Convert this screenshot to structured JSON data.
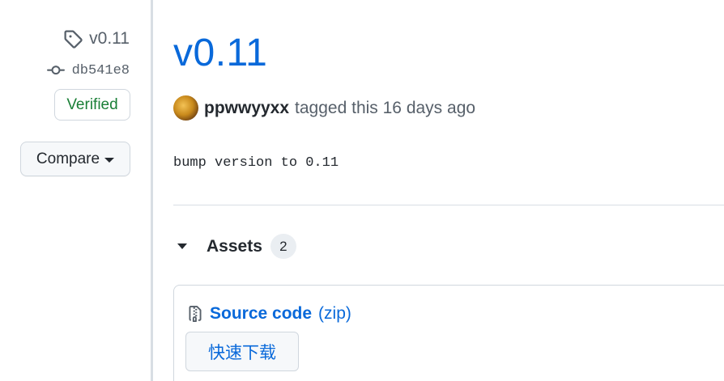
{
  "sidebar": {
    "tag": "v0.11",
    "commit": "db541e8",
    "verified": "Verified",
    "compare": "Compare"
  },
  "release": {
    "title": "v0.11",
    "author": "ppwwyyxx",
    "tagged_text": "tagged this 16 days ago",
    "body": "bump version to 0.11"
  },
  "assets": {
    "label": "Assets",
    "count": "2",
    "items": [
      {
        "name": "Source code",
        "ext": "(zip)"
      }
    ],
    "download_label": "快速下载"
  },
  "colors": {
    "link": "#0969da",
    "verified": "#1a7f37",
    "muted": "#57606a"
  }
}
